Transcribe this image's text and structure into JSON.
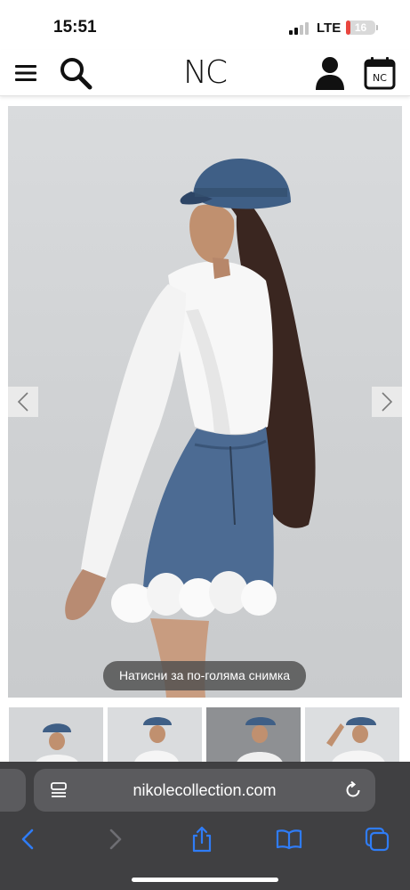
{
  "status_bar": {
    "time": "15:51",
    "network": "LTE",
    "battery_level": "16",
    "battery_fraction": 0.16
  },
  "header": {
    "logo": "NC",
    "icons": [
      "menu-icon",
      "search-icon",
      "account-icon",
      "calendar-nc-icon"
    ],
    "calendar_badge": "NC"
  },
  "gallery": {
    "zoom_hint": "Натисни за по-голяма снимка",
    "prev_icon": "chevron-left-icon",
    "next_icon": "chevron-right-icon"
  },
  "thumbnails": [
    "thumbnail-1",
    "thumbnail-2",
    "thumbnail-3",
    "thumbnail-4"
  ],
  "browser": {
    "url": "nikolecollection.com",
    "toolbar": [
      "back-icon",
      "forward-icon",
      "share-icon",
      "bookmarks-icon",
      "tabs-icon"
    ]
  },
  "colors": {
    "accent_blue": "#2f7cf6",
    "toolbar_bg": "#3a3a3c",
    "battery_red": "#e9463f",
    "denim": "#3f5f86"
  }
}
